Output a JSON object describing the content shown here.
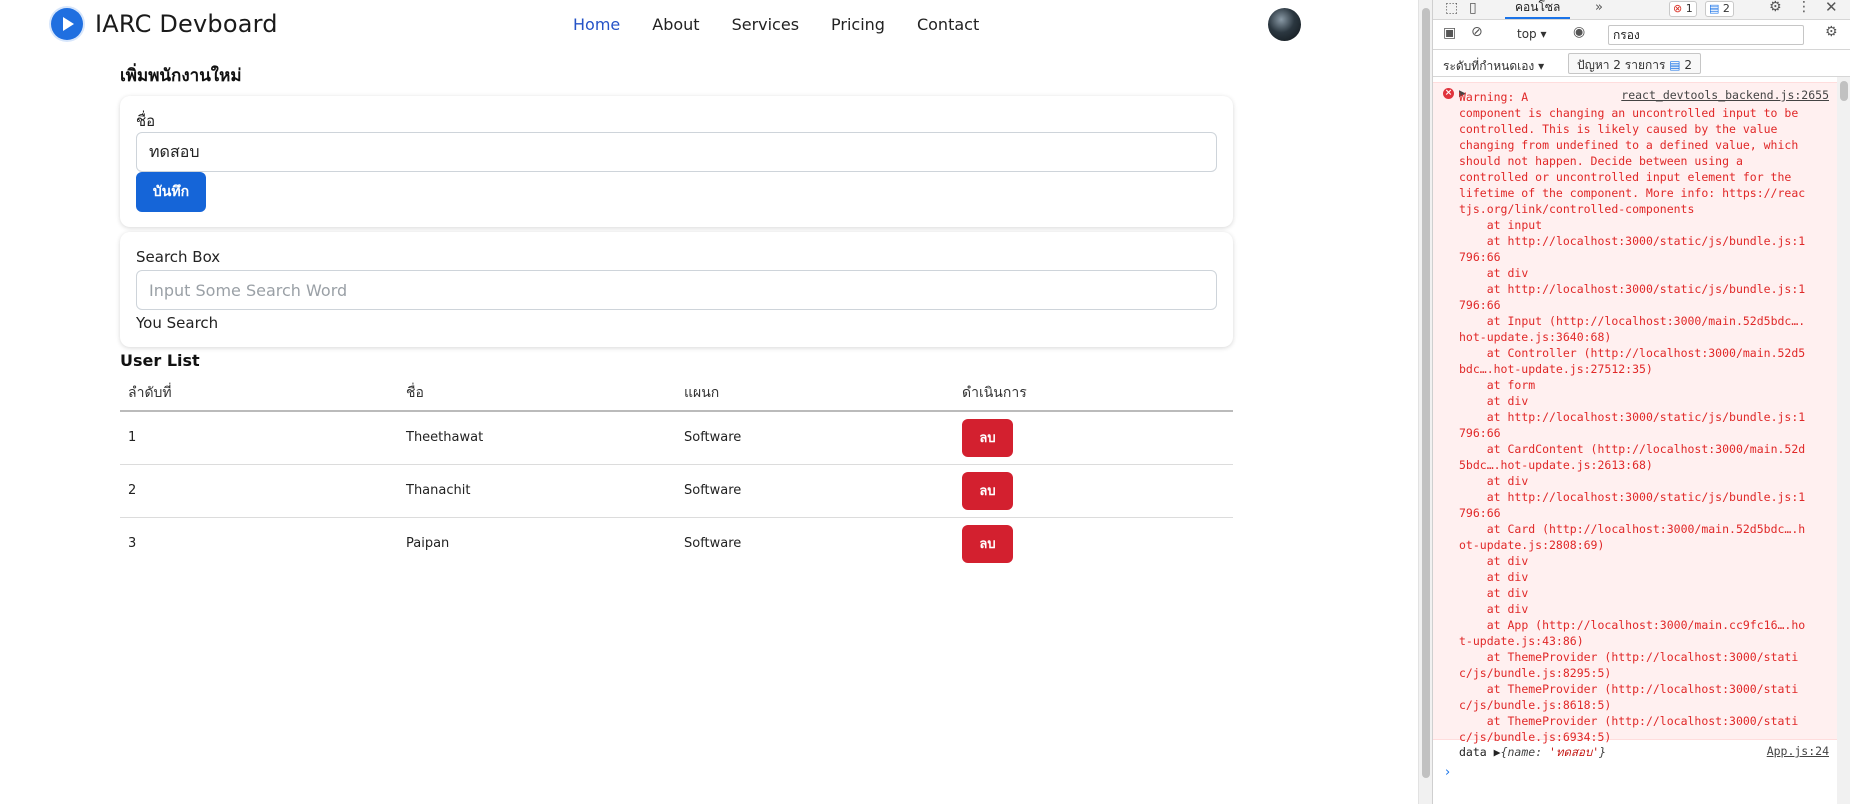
{
  "navbar": {
    "brand": "IARC Devboard",
    "links": [
      "Home",
      "About",
      "Services",
      "Pricing",
      "Contact"
    ],
    "active": "Home"
  },
  "form": {
    "title": "เพิ่มพนักงานใหม่",
    "name_label": "ชื่อ",
    "name_value": "ทดสอบ",
    "save_label": "บันทึก"
  },
  "search": {
    "label": "Search Box",
    "placeholder": "Input Some Search Word",
    "value": "",
    "result_label": "You Search"
  },
  "users": {
    "title": "User List",
    "headers": [
      "ลำดับที่",
      "ชื่อ",
      "แผนก",
      "ดำเนินการ"
    ],
    "rows": [
      {
        "no": "1",
        "name": "Theethawat",
        "dept": "Software",
        "action": "ลบ"
      },
      {
        "no": "2",
        "name": "Thanachit",
        "dept": "Software",
        "action": "ลบ"
      },
      {
        "no": "3",
        "name": "Paipan",
        "dept": "Software",
        "action": "ลบ"
      }
    ]
  },
  "devtools": {
    "console_tab": "คอนโซล",
    "more_tabs": "»",
    "error_count": "1",
    "message_count": "2",
    "context": "top",
    "filter_value": "กรอง",
    "levels_label": "ระดับที่กำหนดเอง",
    "issues_label": "ปัญหา 2 รายการ",
    "issues_count": "2",
    "warning_source": "react_devtools_backend.js:2655",
    "warning_lines": [
      "Warning: A",
      "component is changing an uncontrolled input to be",
      "controlled. This is likely caused by the value",
      "changing from undefined to a defined value, which",
      "should not happen. Decide between using a",
      "controlled or uncontrolled input element for the",
      "lifetime of the component. More info: https://reac",
      "tjs.org/link/controlled-components",
      "    at input",
      "    at http://localhost:3000/static/js/bundle.js:1",
      "796:66",
      "    at div",
      "    at http://localhost:3000/static/js/bundle.js:1",
      "796:66",
      "    at Input (http://localhost:3000/main.52d5bdc….",
      "hot-update.js:3640:68)",
      "    at Controller (http://localhost:3000/main.52d5",
      "bdc….hot-update.js:27512:35)",
      "    at form",
      "    at div",
      "    at http://localhost:3000/static/js/bundle.js:1",
      "796:66",
      "    at CardContent (http://localhost:3000/main.52d",
      "5bdc….hot-update.js:2613:68)",
      "    at div",
      "    at http://localhost:3000/static/js/bundle.js:1",
      "796:66",
      "    at Card (http://localhost:3000/main.52d5bdc….h",
      "ot-update.js:2808:69)",
      "    at div",
      "    at div",
      "    at div",
      "    at div",
      "    at App (http://localhost:3000/main.cc9fc16….ho",
      "t-update.js:43:86)",
      "    at ThemeProvider (http://localhost:3000/stati",
      "c/js/bundle.js:8295:5)",
      "    at ThemeProvider (http://localhost:3000/stati",
      "c/js/bundle.js:8618:5)",
      "    at ThemeProvider (http://localhost:3000/stati",
      "c/js/bundle.js:6934:5)"
    ],
    "log_label": "data",
    "log_object_prefix": "{name: ",
    "log_object_value": "'ทดสอบ'",
    "log_object_suffix": "}",
    "log_source": "App.js:24",
    "prompt": "›"
  }
}
